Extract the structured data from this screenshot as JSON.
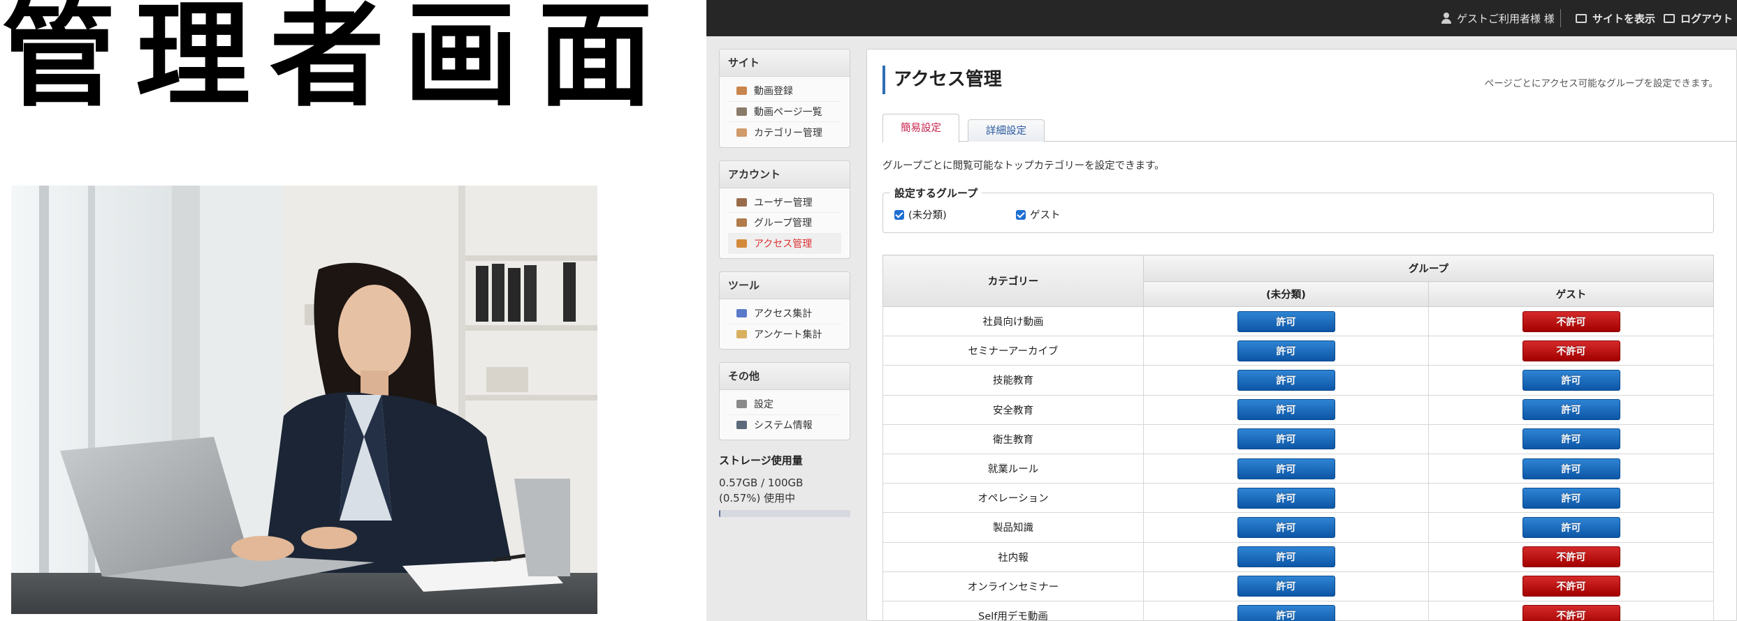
{
  "hero": {
    "title": "管理者画面"
  },
  "topbar": {
    "user_label": "ゲストご利用者様 様",
    "site_label": "サイトを表示",
    "logout_label": "ログアウト"
  },
  "sidebar": {
    "sections": [
      {
        "heading": "サイト",
        "items": [
          {
            "label": "動画登録",
            "icon": "video-add-icon",
            "active": false,
            "color": "#c9854e"
          },
          {
            "label": "動画ページ一覧",
            "icon": "video-list-icon",
            "active": false,
            "color": "#8a7a6a"
          },
          {
            "label": "カテゴリー管理",
            "icon": "category-icon",
            "active": false,
            "color": "#d09a6a"
          }
        ]
      },
      {
        "heading": "アカウント",
        "items": [
          {
            "label": "ユーザー管理",
            "icon": "user-icon",
            "active": false,
            "color": "#9a6b4a"
          },
          {
            "label": "グループ管理",
            "icon": "group-icon",
            "active": false,
            "color": "#b07a4a"
          },
          {
            "label": "アクセス管理",
            "icon": "access-key-icon",
            "active": true,
            "color": "#d48a3a"
          }
        ]
      },
      {
        "heading": "ツール",
        "items": [
          {
            "label": "アクセス集計",
            "icon": "bar-chart-icon",
            "active": false,
            "color": "#5a7ac8"
          },
          {
            "label": "アンケート集計",
            "icon": "survey-icon",
            "active": false,
            "color": "#d8b060"
          }
        ]
      },
      {
        "heading": "その他",
        "items": [
          {
            "label": "設定",
            "icon": "settings-icon",
            "active": false,
            "color": "#8a8a8a"
          },
          {
            "label": "システム情報",
            "icon": "system-info-icon",
            "active": false,
            "color": "#5a6a7a"
          }
        ]
      }
    ],
    "storage": {
      "title": "ストレージ使用量",
      "amount": "0.57GB / 100GB",
      "percent_text": "(0.57%) 使用中",
      "fraction": 0.0057
    }
  },
  "main": {
    "title": "アクセス管理",
    "description": "ページごとにアクセス可能なグループを設定できます。",
    "tabs": [
      {
        "label": "簡易設定",
        "active": true
      },
      {
        "label": "詳細設定",
        "active": false
      }
    ],
    "lead": "グループごとに閲覧可能なトップカテゴリーを設定できます。",
    "group_box": {
      "legend": "設定するグループ",
      "groups": [
        {
          "label": "(未分類)",
          "checked": true
        },
        {
          "label": "ゲスト",
          "checked": true
        }
      ]
    },
    "table": {
      "col_category": "カテゴリー",
      "col_group": "グループ",
      "col_uncategorized": "(未分類)",
      "col_guest": "ゲスト",
      "allow_label": "許可",
      "deny_label": "不許可",
      "rows": [
        {
          "category": "社員向け動画",
          "uncategorized": "allow",
          "guest": "deny"
        },
        {
          "category": "セミナーアーカイブ",
          "uncategorized": "allow",
          "guest": "deny"
        },
        {
          "category": "技能教育",
          "uncategorized": "allow",
          "guest": "allow"
        },
        {
          "category": "安全教育",
          "uncategorized": "allow",
          "guest": "allow"
        },
        {
          "category": "衛生教育",
          "uncategorized": "allow",
          "guest": "allow"
        },
        {
          "category": "就業ルール",
          "uncategorized": "allow",
          "guest": "allow"
        },
        {
          "category": "オペレーション",
          "uncategorized": "allow",
          "guest": "allow"
        },
        {
          "category": "製品知識",
          "uncategorized": "allow",
          "guest": "allow"
        },
        {
          "category": "社内報",
          "uncategorized": "allow",
          "guest": "deny"
        },
        {
          "category": "オンラインセミナー",
          "uncategorized": "allow",
          "guest": "deny"
        },
        {
          "category": "Self用デモ動画",
          "uncategorized": "allow",
          "guest": "deny"
        }
      ]
    }
  }
}
